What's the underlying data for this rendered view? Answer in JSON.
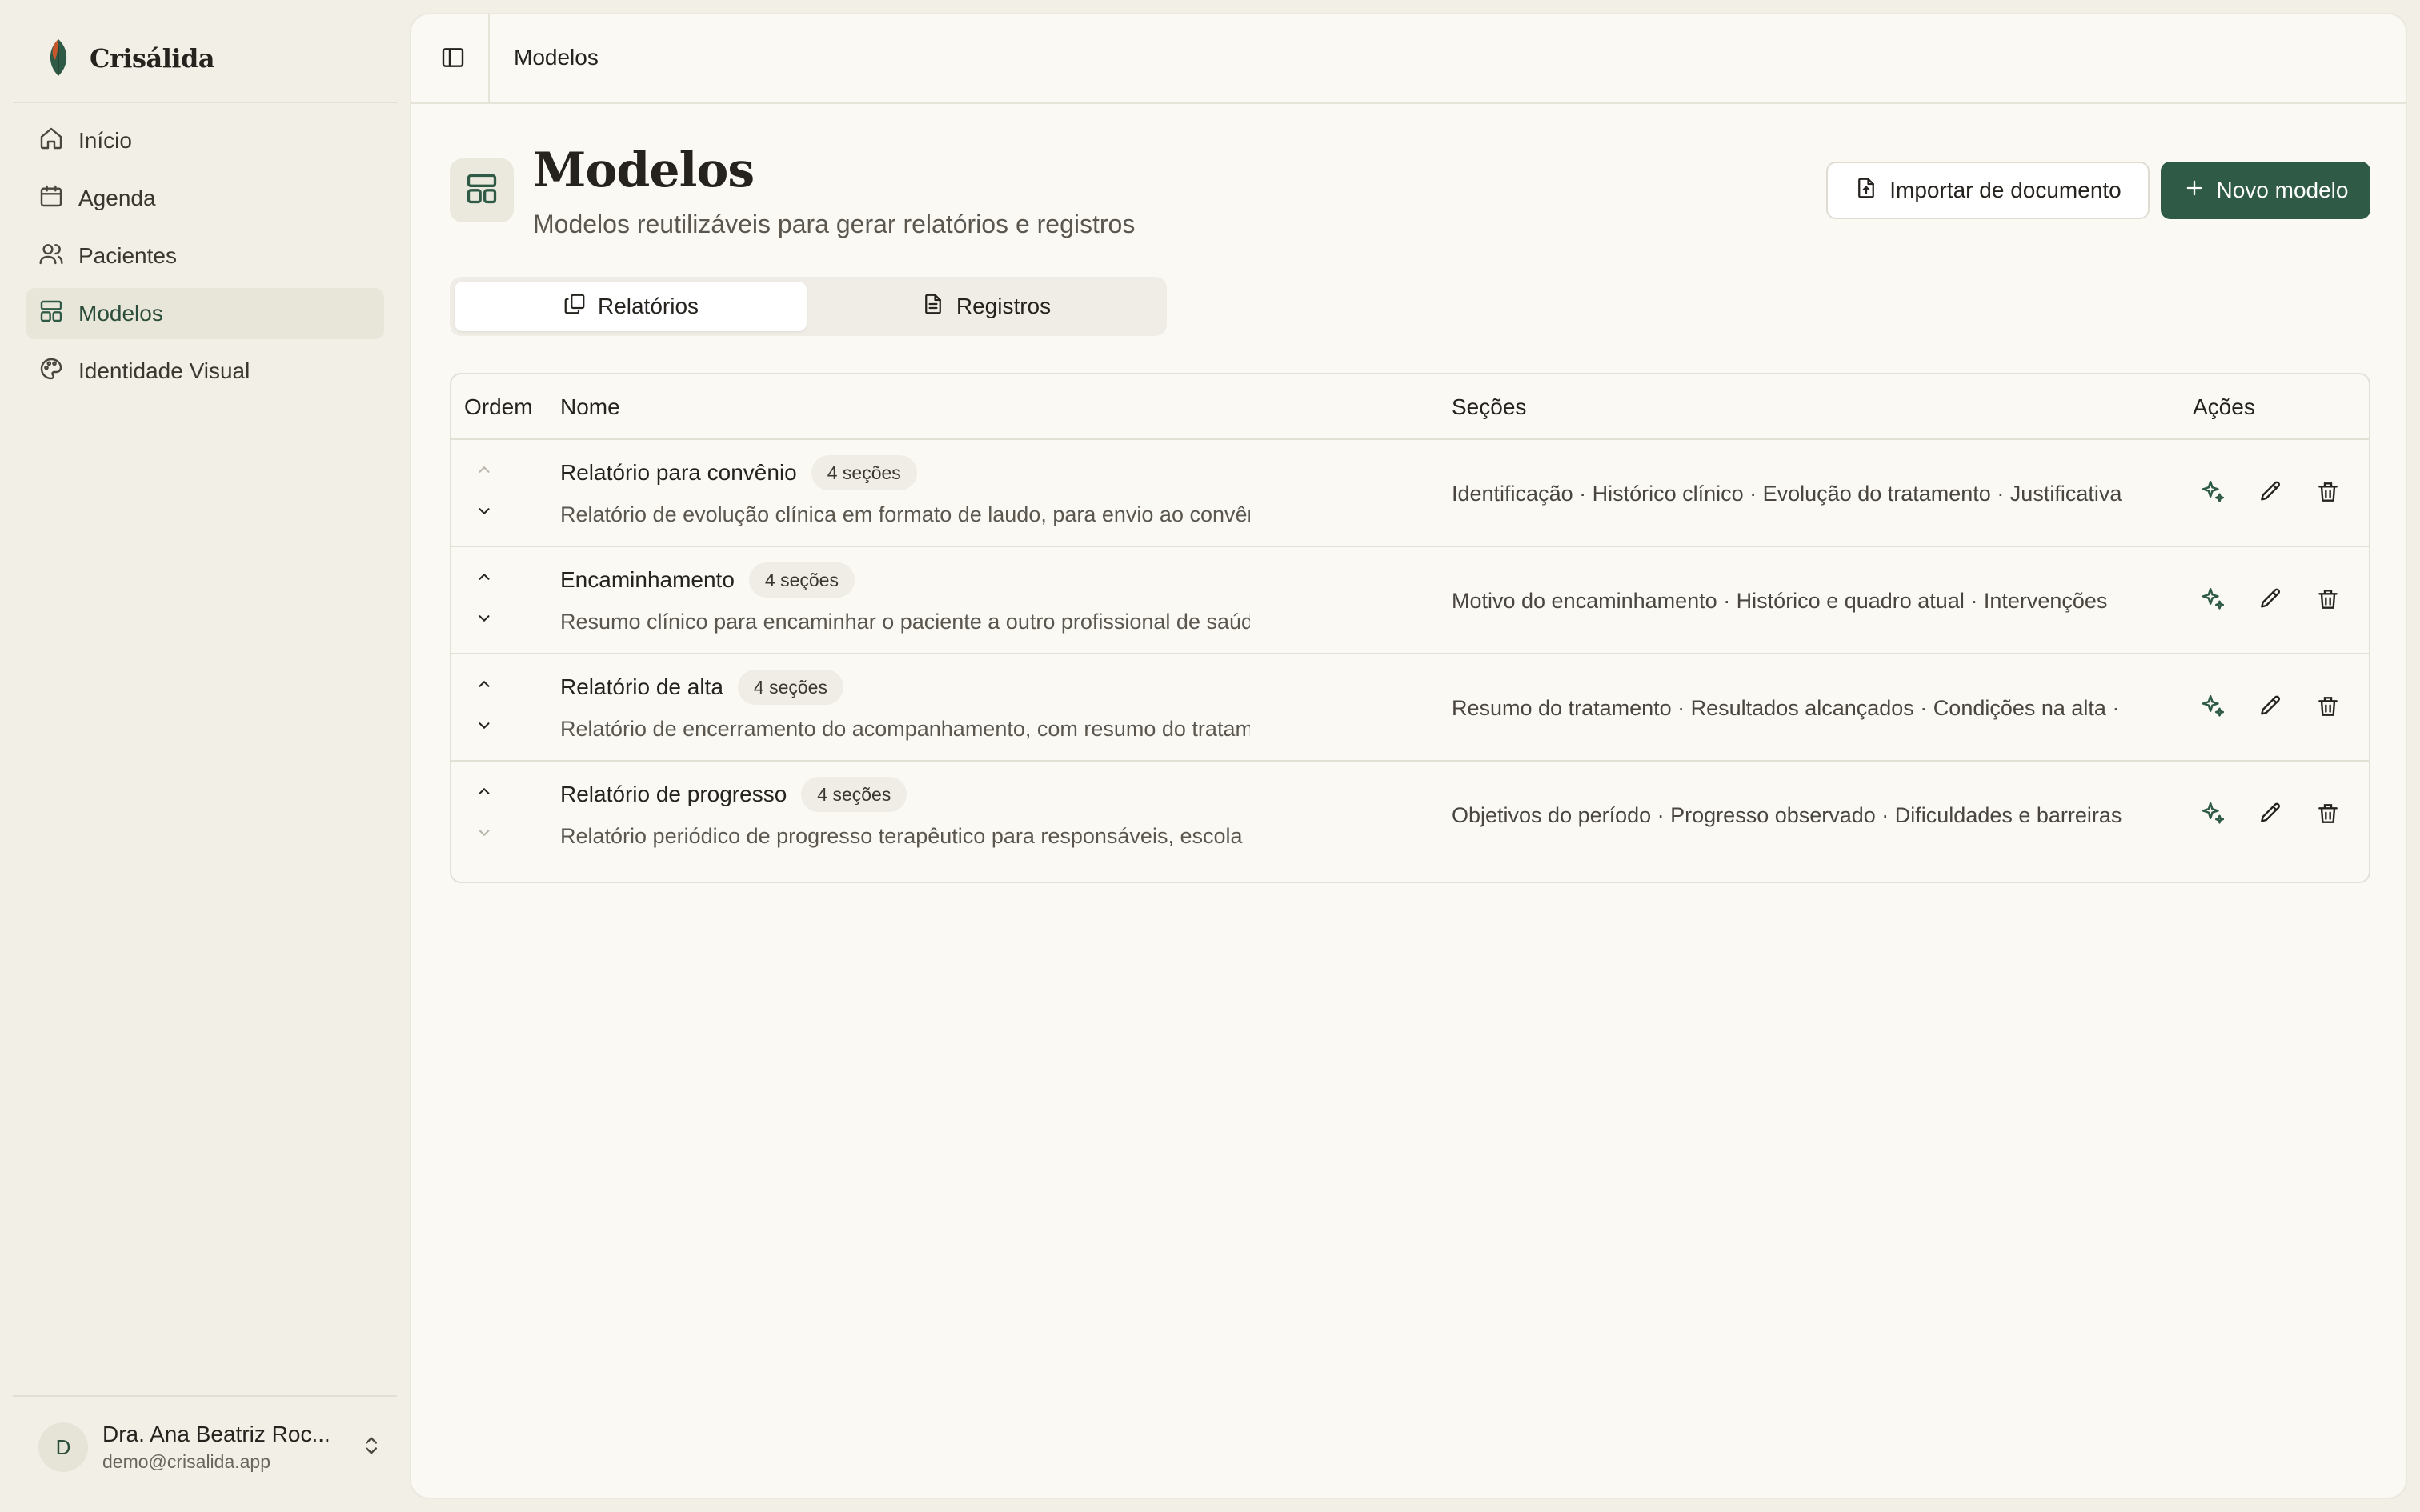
{
  "brand": {
    "name": "Crisálida"
  },
  "sidebar": {
    "items": [
      {
        "label": "Início",
        "icon": "home-icon"
      },
      {
        "label": "Agenda",
        "icon": "calendar-icon"
      },
      {
        "label": "Pacientes",
        "icon": "users-icon"
      },
      {
        "label": "Modelos",
        "icon": "layout-icon",
        "active": true
      },
      {
        "label": "Identidade Visual",
        "icon": "palette-icon"
      }
    ]
  },
  "user": {
    "initial": "D",
    "name": "Dra. Ana Beatriz Roc...",
    "email": "demo@crisalida.app"
  },
  "topbar": {
    "breadcrumb": "Modelos"
  },
  "page": {
    "title": "Modelos",
    "subtitle": "Modelos reutilizáveis para gerar relatórios e registros",
    "import_label": "Importar de documento",
    "new_label": "Novo modelo"
  },
  "tabs": [
    {
      "label": "Relatórios",
      "active": true
    },
    {
      "label": "Registros",
      "active": false
    }
  ],
  "table": {
    "headers": {
      "order": "Ordem",
      "name": "Nome",
      "sections": "Seções",
      "actions": "Ações"
    },
    "rows": [
      {
        "name": "Relatório para convênio",
        "badge": "4 seções",
        "description": "Relatório de evolução clínica em formato de laudo, para envio ao convênio",
        "sections": "Identificação · Histórico clínico · Evolução do tratamento · Justificativa"
      },
      {
        "name": "Encaminhamento",
        "badge": "4 seções",
        "description": "Resumo clínico para encaminhar o paciente a outro profissional de saúde",
        "sections": "Motivo do encaminhamento · Histórico e quadro atual · Intervenções"
      },
      {
        "name": "Relatório de alta",
        "badge": "4 seções",
        "description": "Relatório de encerramento do acompanhamento, com resumo do tratamento",
        "sections": "Resumo do tratamento · Resultados alcançados · Condições na alta ·"
      },
      {
        "name": "Relatório de progresso",
        "badge": "4 seções",
        "description": "Relatório periódico de progresso terapêutico para responsáveis, escola",
        "sections": "Objetivos do período · Progresso observado · Dificuldades e barreiras"
      }
    ]
  },
  "colors": {
    "accent": "#2f5a45",
    "background": "#f1efe6",
    "panel": "#faf9f4"
  }
}
